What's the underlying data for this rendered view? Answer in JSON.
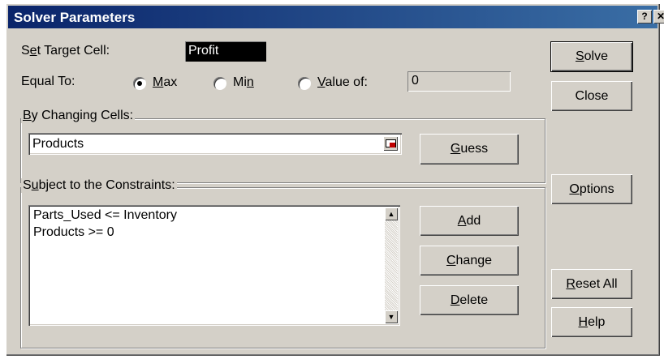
{
  "window": {
    "title": "Solver Parameters",
    "help_glyph": "?",
    "close_glyph": "✕"
  },
  "target": {
    "label_pre": "S",
    "label_u": "e",
    "label_post": "t Target Cell:",
    "value": "Profit"
  },
  "equal_to": {
    "label": "Equal To:",
    "max": {
      "pre": "",
      "u": "M",
      "post": "ax",
      "checked": true
    },
    "min": {
      "pre": "Mi",
      "u": "n",
      "post": "",
      "checked": false
    },
    "value_of": {
      "pre": "",
      "u": "V",
      "post": "alue of:",
      "checked": false,
      "value": "0"
    }
  },
  "changing": {
    "label_pre": "",
    "label_u": "B",
    "label_post": "y Changing Cells:",
    "value": "Products",
    "guess": {
      "pre": "",
      "u": "G",
      "post": "uess"
    }
  },
  "constraints": {
    "label_pre": "S",
    "label_u": "u",
    "label_post": "bject to the Constraints:",
    "items": [
      "Parts_Used <= Inventory",
      "Products >= 0"
    ],
    "add": {
      "pre": "",
      "u": "A",
      "post": "dd"
    },
    "change": {
      "pre": "",
      "u": "C",
      "post": "hange"
    },
    "delete": {
      "pre": "",
      "u": "D",
      "post": "elete"
    }
  },
  "side_buttons": {
    "solve": {
      "pre": "",
      "u": "S",
      "post": "olve"
    },
    "close": {
      "label": "Close"
    },
    "options": {
      "pre": "",
      "u": "O",
      "post": "ptions"
    },
    "reset": {
      "pre": "",
      "u": "R",
      "post": "eset All"
    },
    "help": {
      "pre": "",
      "u": "H",
      "post": "elp"
    }
  },
  "icons": {
    "collapse": "range-collapse-icon",
    "scroll_up": "scroll-up-icon",
    "scroll_down": "scroll-down-icon"
  }
}
